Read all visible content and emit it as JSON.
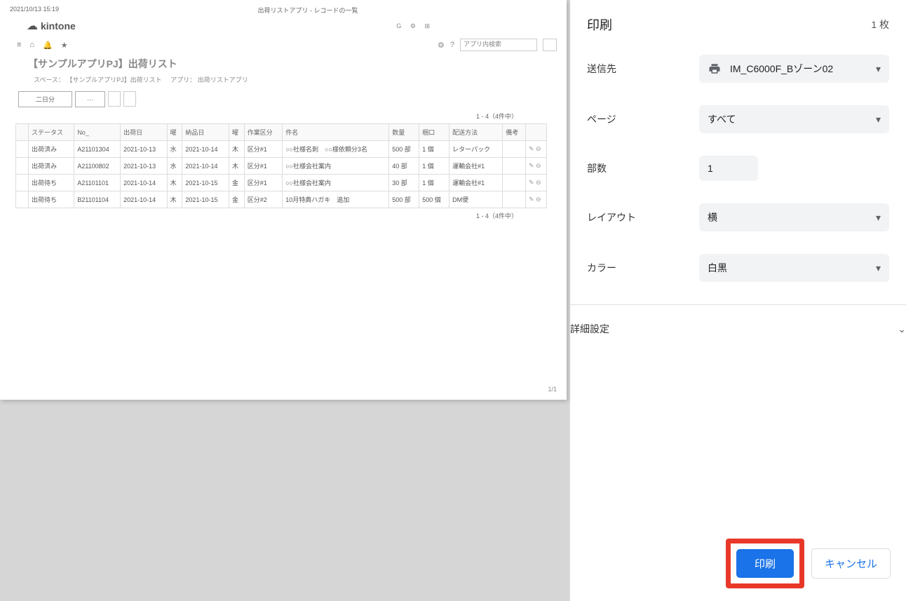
{
  "preview": {
    "timestamp": "2021/10/13 15:19",
    "doc_title": "出荷リストアプリ - レコードの一覧",
    "brand": "kintone",
    "search_placeholder": "アプリ内検索",
    "page_title": "【サンプルアプリPJ】出荷リスト",
    "breadcrumb_space_label": "スペース：",
    "breadcrumb_space": "【サンプルアプリPJ】出荷リスト",
    "breadcrumb_app_label": "アプリ：",
    "breadcrumb_app": "出荷リストアプリ",
    "filter1": "二日分",
    "filter2": "…",
    "count_text": "1 - 4（4件中）",
    "page_num": "1/1",
    "headers": [
      "ステータス",
      "No_",
      "出荷日",
      "曜",
      "納品日",
      "曜",
      "作業区分",
      "件名",
      "数量",
      "梱口",
      "配送方法",
      "備考"
    ],
    "rows": [
      [
        "出荷済み",
        "A21101304",
        "2021-10-13",
        "水",
        "2021-10-14",
        "木",
        "区分#1",
        "○○社様名刺　○○様依頼分3名",
        "500 部",
        "1 個",
        "レターパック",
        ""
      ],
      [
        "出荷済み",
        "A21100802",
        "2021-10-13",
        "水",
        "2021-10-14",
        "木",
        "区分#1",
        "○○社様会社案内",
        "40 部",
        "1 個",
        "運輸会社#1",
        ""
      ],
      [
        "出荷待ち",
        "A21101101",
        "2021-10-14",
        "木",
        "2021-10-15",
        "金",
        "区分#1",
        "○○社様会社案内",
        "30 部",
        "1 個",
        "運輸会社#1",
        ""
      ],
      [
        "出荷待ち",
        "B21101104",
        "2021-10-14",
        "木",
        "2021-10-15",
        "金",
        "区分#2",
        "10月特典ハガキ　追加",
        "500 部",
        "500 個",
        "DM便",
        ""
      ]
    ]
  },
  "dialog": {
    "title": "印刷",
    "page_count": "1 枚",
    "destination_label": "送信先",
    "destination_value": "IM_C6000F_Bゾーン02",
    "pages_label": "ページ",
    "pages_value": "すべて",
    "copies_label": "部数",
    "copies_value": "1",
    "layout_label": "レイアウト",
    "layout_value": "横",
    "color_label": "カラー",
    "color_value": "白黒",
    "advanced_label": "詳細設定",
    "print_btn": "印刷",
    "cancel_btn": "キャンセル"
  }
}
